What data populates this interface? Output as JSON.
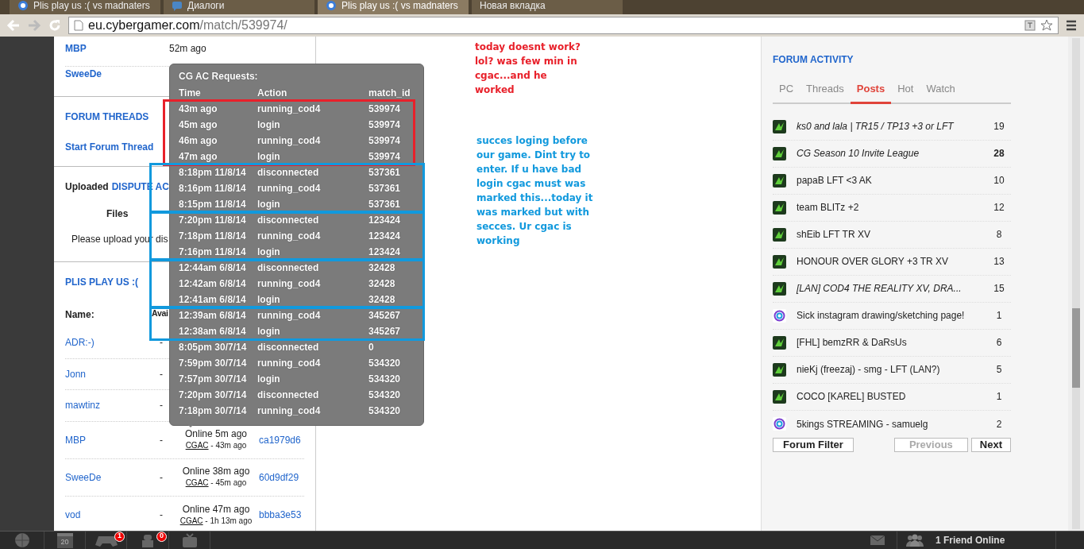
{
  "browser": {
    "tabs": [
      {
        "title": "Plis play us :( vs madnaters",
        "kind": "site",
        "selected": false
      },
      {
        "title": "Диалоги",
        "kind": "chat",
        "selected": false
      },
      {
        "title": "Plis play us :( vs madnaters",
        "kind": "site",
        "selected": true
      },
      {
        "title": "Новая вкладка",
        "kind": "blank",
        "selected": false
      }
    ],
    "address": {
      "host": "eu.cybergamer.com",
      "path": "/match/539974/"
    }
  },
  "left": {
    "recent": [
      {
        "name": "MBP",
        "time": "52m ago"
      },
      {
        "name": "SweeDe"
      }
    ],
    "forum_threads": {
      "title": "FORUM THREADS",
      "link": "Start Forum Thread"
    },
    "dispute": {
      "label": "Uploaded",
      "link": "DISPUTE AC",
      "files_heading": "Files",
      "note": "Please upload your dis"
    },
    "team": {
      "title": "PLIS PLAY US :(",
      "columns": [
        "Name:",
        "Avai"
      ],
      "rows": [
        {
          "name": "ADR:-)",
          "available": "-"
        },
        {
          "name": "Jonn",
          "available": "-"
        },
        {
          "name": "mawtinz",
          "available": "-"
        },
        {
          "name": "MBP",
          "available": "-",
          "status": "Online 5m ago",
          "cgac": "CGAC",
          "cgac_time": "- 43m ago",
          "guid": "ca1979d6"
        },
        {
          "name": "SweeDe",
          "available": "-",
          "status": "Online 38m ago",
          "cgac": "CGAC",
          "cgac_time": "- 45m ago",
          "guid": "60d9df29"
        },
        {
          "name": "vod",
          "available": "-",
          "status": "Online 47m ago",
          "cgac": "CGAC",
          "cgac_time": "- 1h 13m ago",
          "guid": "bbba3e53"
        }
      ]
    }
  },
  "tooltip": {
    "title": "CG AC Requests:",
    "columns": [
      "Time",
      "Action",
      "match_id"
    ],
    "groups": [
      {
        "color": "#e8202a",
        "rows": [
          [
            "43m ago",
            "running_cod4",
            "539974"
          ],
          [
            "45m ago",
            "login",
            "539974"
          ],
          [
            "46m ago",
            "running_cod4",
            "539974"
          ],
          [
            "47m ago",
            "login",
            "539974"
          ]
        ]
      },
      {
        "color": "#1199dd",
        "rows": [
          [
            "8:18pm 11/8/14",
            "disconnected",
            "537361"
          ],
          [
            "8:16pm 11/8/14",
            "running_cod4",
            "537361"
          ],
          [
            "8:15pm 11/8/14",
            "login",
            "537361"
          ]
        ]
      },
      {
        "color": "#1199dd",
        "rows": [
          [
            "7:20pm 11/8/14",
            "disconnected",
            "123424"
          ],
          [
            "7:18pm 11/8/14",
            "running_cod4",
            "123424"
          ],
          [
            "7:16pm 11/8/14",
            "login",
            "123424"
          ]
        ]
      },
      {
        "color": "#1199dd",
        "rows": [
          [
            "12:44am 6/8/14",
            "disconnected",
            "32428"
          ],
          [
            "12:42am 6/8/14",
            "running_cod4",
            "32428"
          ],
          [
            "12:41am 6/8/14",
            "login",
            "32428"
          ]
        ]
      },
      {
        "color": "#1199dd",
        "rows": [
          [
            "12:39am 6/8/14",
            "running_cod4",
            "345267"
          ],
          [
            "12:38am 6/8/14",
            "login",
            "345267"
          ]
        ]
      },
      {
        "rows": [
          [
            "8:05pm 30/7/14",
            "disconnected",
            "0"
          ],
          [
            "7:59pm 30/7/14",
            "running_cod4",
            "534320"
          ],
          [
            "7:57pm 30/7/14",
            "login",
            "534320"
          ],
          [
            "7:20pm 30/7/14",
            "disconnected",
            "534320"
          ],
          [
            "7:18pm 30/7/14",
            "running_cod4",
            "534320"
          ]
        ]
      }
    ]
  },
  "notes": [
    {
      "text": "today doesnt work? lol? was few min in cgac...and he worked",
      "color": "#e8202a"
    },
    {
      "text": "succes loging before our game. Dint try to enter. If u have bad login cgac must was marked this...today it was marked but with secces. Ur cgac is working",
      "color": "#1199dd"
    }
  ],
  "forum_activity": {
    "title": "FORUM ACTIVITY",
    "tabs": [
      {
        "label": "PC",
        "selected": false
      },
      {
        "label": "Threads",
        "selected": false
      },
      {
        "label": "Posts",
        "selected": true
      },
      {
        "label": "Hot",
        "selected": false
      },
      {
        "label": "Watch",
        "selected": false
      }
    ],
    "threads": [
      {
        "title": "ks0 and lala | TR15 / TP13 +3 or LFT",
        "count": "19",
        "kind": "game",
        "italic": true,
        "bold_count": false
      },
      {
        "title": "CG Season 10 Invite League",
        "count": "28",
        "kind": "game",
        "italic": true,
        "bold_count": true
      },
      {
        "title": "papaB LFT <3 AK",
        "count": "10",
        "kind": "game",
        "italic": false,
        "bold_count": false
      },
      {
        "title": "team BLITz +2",
        "count": "12",
        "kind": "game",
        "italic": false,
        "bold_count": false
      },
      {
        "title": "shEib LFT TR XV",
        "count": "8",
        "kind": "game",
        "italic": false,
        "bold_count": false
      },
      {
        "title": "HONOUR OVER GLORY +3 TR XV",
        "count": "13",
        "kind": "game",
        "italic": false,
        "bold_count": false
      },
      {
        "title": "[LAN] COD4 THE REALITY XV, DRA...",
        "count": "15",
        "kind": "game",
        "italic": true,
        "bold_count": false
      },
      {
        "title": "Sick instagram drawing/sketching page!",
        "count": "1",
        "kind": "general",
        "italic": false,
        "bold_count": false
      },
      {
        "title": "[FHL] bemzRR & DaRsUs",
        "count": "6",
        "kind": "game",
        "italic": false,
        "bold_count": false
      },
      {
        "title": "nieKj (freezaj) - smg - LFT (LAN?)",
        "count": "5",
        "kind": "game",
        "italic": false,
        "bold_count": false
      },
      {
        "title": "COCO [KAREL] BUSTED",
        "count": "1",
        "kind": "game",
        "italic": false,
        "bold_count": false
      },
      {
        "title": "5kings STREAMING - samuelg",
        "count": "2",
        "kind": "general",
        "italic": false,
        "bold_count": false
      }
    ],
    "buttons": [
      {
        "label": "Forum Filter",
        "disabled": false
      },
      {
        "label": "Previous",
        "disabled": true
      },
      {
        "label": "Next",
        "disabled": false
      }
    ]
  },
  "bottom_bar": {
    "calendar_day": "20",
    "game_badge": "1",
    "bot_badge": "0",
    "friends": "1 Friend Online"
  }
}
